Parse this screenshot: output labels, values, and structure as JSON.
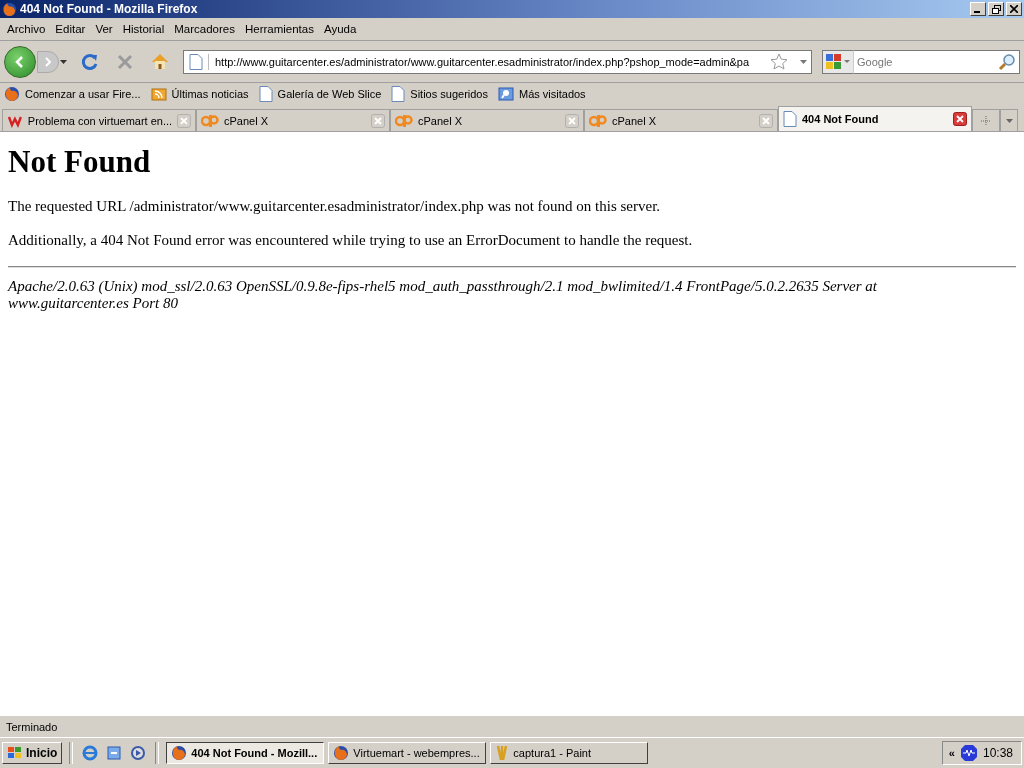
{
  "window": {
    "title": "404 Not Found - Mozilla Firefox"
  },
  "menu": [
    {
      "label": "Archivo"
    },
    {
      "label": "Editar"
    },
    {
      "label": "Ver"
    },
    {
      "label": "Historial"
    },
    {
      "label": "Marcadores"
    },
    {
      "label": "Herramientas"
    },
    {
      "label": "Ayuda"
    }
  ],
  "navbar": {
    "url": "http://www.guitarcenter.es/administrator/www.guitarcenter.esadministrator/index.php?pshop_mode=admin&pa",
    "search_placeholder": "Google"
  },
  "bookmarks": [
    {
      "label": "Comenzar a usar Fire...",
      "kind": "firefox"
    },
    {
      "label": "Últimas noticias",
      "kind": "feed"
    },
    {
      "label": "Galería de Web Slice",
      "kind": "page"
    },
    {
      "label": "Sitios sugeridos",
      "kind": "page"
    },
    {
      "label": "Más visitados",
      "kind": "search"
    }
  ],
  "tabs": [
    {
      "label": "Problema con virtuemart en...",
      "kind": "w",
      "selected": false
    },
    {
      "label": "cPanel X",
      "kind": "cpanel",
      "selected": false
    },
    {
      "label": "cPanel X",
      "kind": "cpanel",
      "selected": false
    },
    {
      "label": "cPanel X",
      "kind": "cpanel",
      "selected": false
    },
    {
      "label": "404 Not Found",
      "kind": "page",
      "selected": true
    }
  ],
  "content": {
    "heading": "Not Found",
    "paragraphs": [
      "The requested URL /administrator/www.guitarcenter.esadministrator/index.php was not found on this server.",
      "Additionally, a 404 Not Found error was encountered while trying to use an ErrorDocument to handle the request."
    ],
    "address": "Apache/2.0.63 (Unix) mod_ssl/2.0.63 OpenSSL/0.9.8e-fips-rhel5 mod_auth_passthrough/2.1 mod_bwlimited/1.4 FrontPage/5.0.2.2635 Server at www.guitarcenter.es Port 80"
  },
  "status_bar": {
    "text": "Terminado"
  },
  "taskbar": {
    "start": "Inicio",
    "tasks": [
      {
        "label": "404 Not Found - Mozill...",
        "kind": "firefox",
        "selected": true
      },
      {
        "label": "Virtuemart - webempres...",
        "kind": "firefox",
        "selected": false
      },
      {
        "label": "captura1 - Paint",
        "kind": "paint",
        "selected": false
      }
    ],
    "tray_chevron": "«",
    "clock": "10:38"
  }
}
